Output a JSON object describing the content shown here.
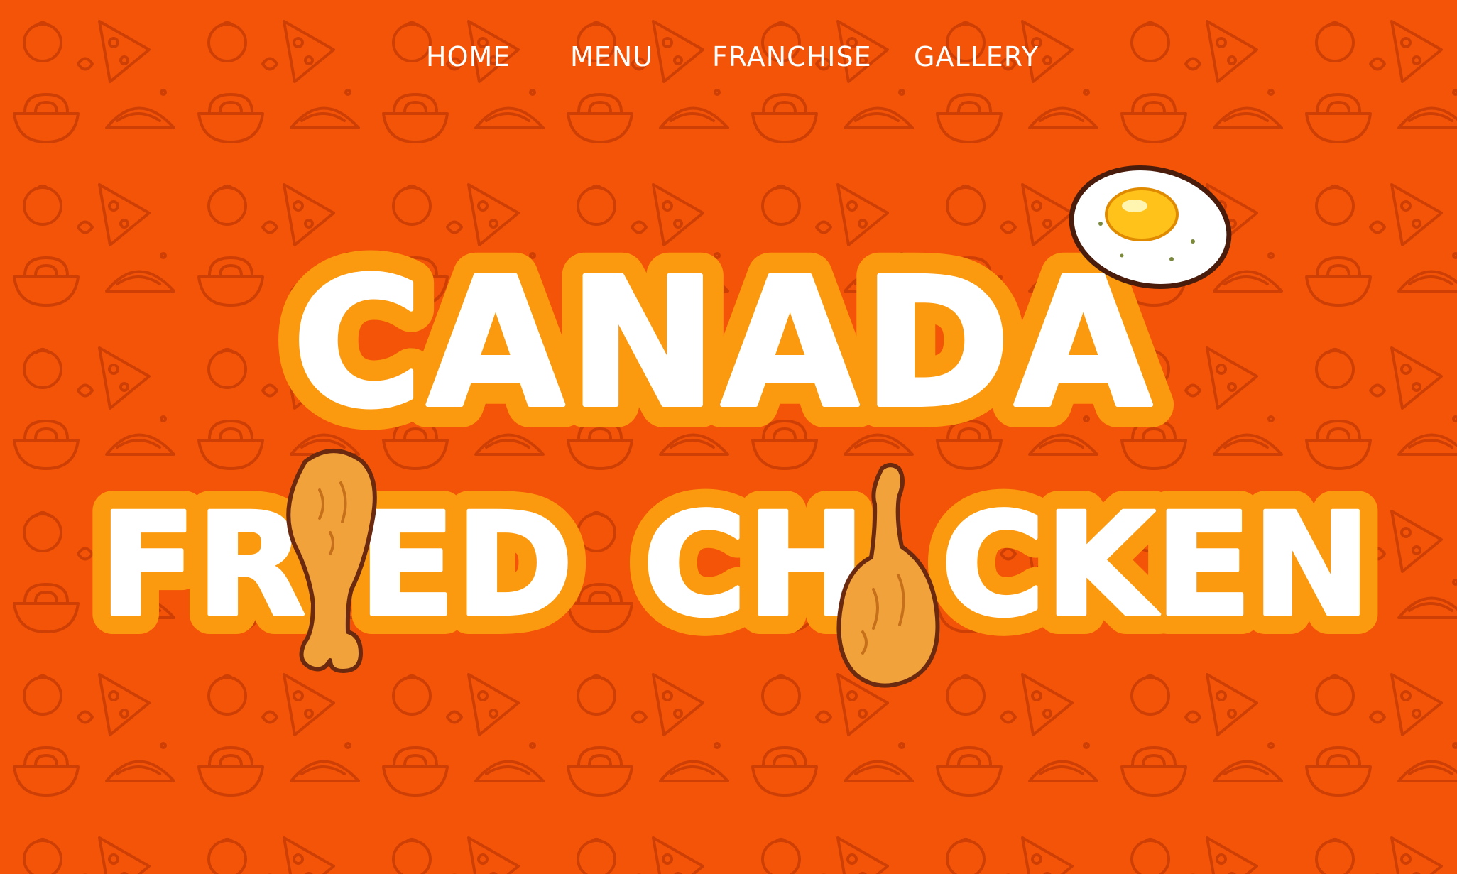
{
  "nav": {
    "items": [
      {
        "label": "HOME"
      },
      {
        "label": "MENU"
      },
      {
        "label": "FRANCHISE"
      },
      {
        "label": "GALLERY"
      }
    ]
  },
  "hero": {
    "line1": "CANADA",
    "line2_part_a": "FR",
    "line2_part_b": "ED",
    "line2_part_c": "CH",
    "line2_part_d": "CKEN"
  },
  "colors": {
    "background": "#f35407",
    "pattern_stroke": "#c83a04",
    "logo_fill": "#ffffff",
    "logo_outline": "#fb9a0e",
    "chicken": "#f1a23a",
    "chicken_outline": "#6b2a10",
    "yolk": "#ffc21a"
  },
  "icons": [
    "fried-egg-icon",
    "chicken-drumstick-icon",
    "food-pattern-icon"
  ]
}
